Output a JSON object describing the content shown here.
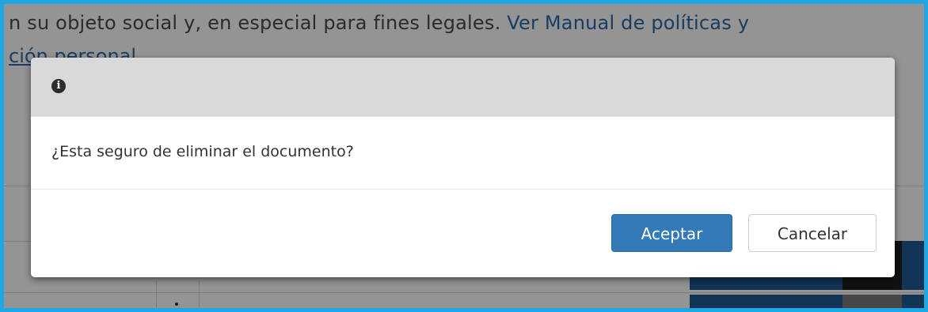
{
  "background": {
    "text_line1": "n su objeto social y, en especial para fines legales.",
    "link_line1": "Ver Manual de políticas y",
    "link_line2": "ción personal"
  },
  "dialog": {
    "icon": "info-icon",
    "icon_glyph": "i",
    "message": "¿Esta seguro de eliminar el documento?",
    "accept_label": "Aceptar",
    "cancel_label": "Cancelar"
  },
  "colors": {
    "frame_border": "#1ea7e4",
    "primary_button": "#337ab7",
    "header_background": "#d9d9d9"
  }
}
